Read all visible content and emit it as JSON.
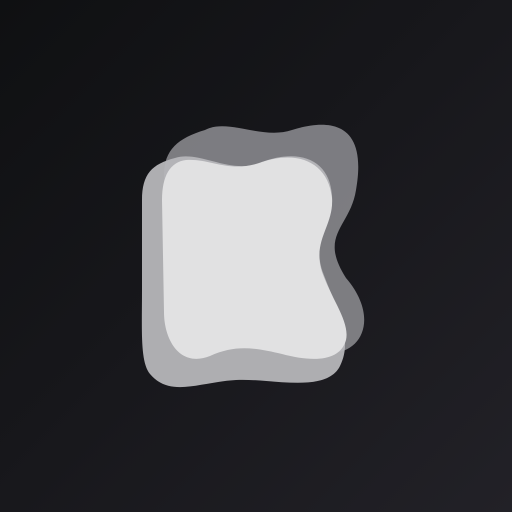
{
  "logo": {
    "icon": "stacked-blob-logo-icon",
    "colors": {
      "background_dark": "#0f1012",
      "background_light": "#222127",
      "back_layer": "#8a8a8e",
      "middle_layer": "#b8b8bb",
      "front_layer": "#e2e2e3"
    }
  }
}
